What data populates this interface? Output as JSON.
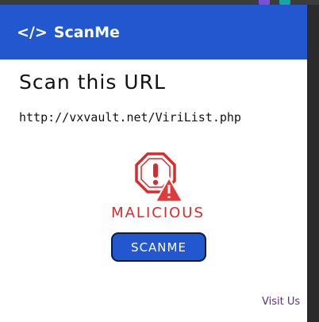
{
  "header": {
    "title": "ScanMe",
    "icon": "code-icon",
    "icon_glyph": "</>"
  },
  "main": {
    "heading": "Scan this URL",
    "url": "http://vxvault.net/ViriList.php",
    "verdict": {
      "label": "MALICIOUS",
      "icon": "malicious-warning-icon",
      "color": "#d62c2c"
    },
    "scan_button_label": "SCANME"
  },
  "footer": {
    "visit_link_label": "Visit Us"
  },
  "colors": {
    "brand": "#2357cf",
    "danger": "#d62c2c",
    "link": "#5b2f86"
  }
}
